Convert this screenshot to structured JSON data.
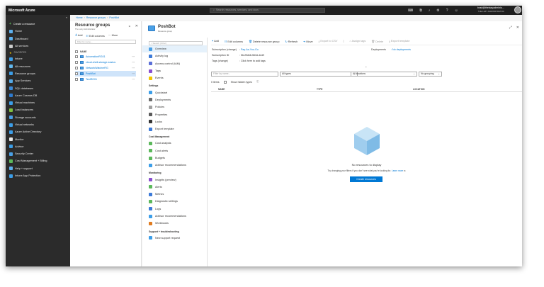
{
  "topbar": {
    "brand": "Microsoft Azure",
    "search_placeholder": "Search resources, services, and docs",
    "user_name": "brad@thelazyadminis...",
    "user_org": "THE LAZY ADMINISTRATOR"
  },
  "leftnav": {
    "collapse": "«",
    "create": "Create a resource",
    "items_top": [
      {
        "label": "Home",
        "color": "#5db0ee"
      },
      {
        "label": "Dashboard",
        "color": "#5db0ee"
      },
      {
        "label": "All services",
        "color": "#cccccc"
      }
    ],
    "favorites_label": "FAVORITES",
    "favorites": [
      {
        "label": "Intune",
        "color": "#3c9ee8"
      },
      {
        "label": "All resources",
        "color": "#62b8ee"
      },
      {
        "label": "Resource groups",
        "color": "#3c9ee8"
      },
      {
        "label": "App Services",
        "color": "#55a9e6"
      },
      {
        "label": "SQL databases",
        "color": "#3c8ad8"
      },
      {
        "label": "Azure Cosmos DB",
        "color": "#2d7bd0"
      },
      {
        "label": "Virtual machines",
        "color": "#3c9ee8"
      },
      {
        "label": "Load balancers",
        "color": "#7fbf3f"
      },
      {
        "label": "Storage accounts",
        "color": "#4aa0e6"
      },
      {
        "label": "Virtual networks",
        "color": "#3c9ee8"
      },
      {
        "label": "Azure Active Directory",
        "color": "#3c9ee8"
      },
      {
        "label": "Monitor",
        "color": "#e8e8e8"
      },
      {
        "label": "Advisor",
        "color": "#3c9ee8"
      },
      {
        "label": "Security Center",
        "color": "#4aa0e6"
      },
      {
        "label": "Cost Management + Billing",
        "color": "#5bb85b"
      },
      {
        "label": "Help + support",
        "color": "#5db0ee"
      },
      {
        "label": "Intune App Protection",
        "color": "#3c9ee8"
      }
    ]
  },
  "breadcrumb": [
    "Home",
    "Resource groups",
    "PoshBot"
  ],
  "rg_blade": {
    "title": "Resource groups",
    "subtitle": "The Lazy Administrator",
    "add": "Add",
    "edit_columns": "Edit columns",
    "more": "More",
    "filter_placeholder": "Filter by name...",
    "col_name": "NAME",
    "rows": [
      {
        "name": "AutomationRG01",
        "selected": false
      },
      {
        "name": "cloud-shell-storage-eastus",
        "selected": false
      },
      {
        "name": "NetworkWatcherRG",
        "selected": false
      },
      {
        "name": "PoshBot",
        "selected": true
      },
      {
        "name": "TestRG01",
        "selected": false
      }
    ]
  },
  "posh_blade": {
    "title": "PoshBot",
    "subtitle": "Resource group",
    "menu_search_placeholder": "Search (Ctrl+/)",
    "menu": [
      {
        "type": "item",
        "label": "Overview",
        "icon": "overview-icon",
        "color": "#4aa0e6",
        "active": true
      },
      {
        "type": "item",
        "label": "Activity log",
        "icon": "activity-log-icon",
        "color": "#3c7ad8"
      },
      {
        "type": "item",
        "label": "Access control (IAM)",
        "icon": "iam-icon",
        "color": "#5a6fd8"
      },
      {
        "type": "item",
        "label": "Tags",
        "icon": "tag-icon",
        "color": "#8a4fd0"
      },
      {
        "type": "item",
        "label": "Events",
        "icon": "events-icon",
        "color": "#f2c500"
      },
      {
        "type": "section",
        "label": "Settings"
      },
      {
        "type": "item",
        "label": "Quickstart",
        "icon": "quickstart-icon",
        "color": "#3c9ee8"
      },
      {
        "type": "item",
        "label": "Deployments",
        "icon": "deployments-icon",
        "color": "#6b6b6b"
      },
      {
        "type": "item",
        "label": "Policies",
        "icon": "policies-icon",
        "color": "#a0a0a0"
      },
      {
        "type": "item",
        "label": "Properties",
        "icon": "properties-icon",
        "color": "#5a5a5a"
      },
      {
        "type": "item",
        "label": "Locks",
        "icon": "lock-icon",
        "color": "#333333"
      },
      {
        "type": "item",
        "label": "Export template",
        "icon": "export-template-icon",
        "color": "#3c7ad8"
      },
      {
        "type": "section",
        "label": "Cost Management"
      },
      {
        "type": "item",
        "label": "Cost analysis",
        "icon": "cost-analysis-icon",
        "color": "#5bb85b"
      },
      {
        "type": "item",
        "label": "Cost alerts",
        "icon": "cost-alerts-icon",
        "color": "#5bb85b"
      },
      {
        "type": "item",
        "label": "Budgets",
        "icon": "budgets-icon",
        "color": "#5bb85b"
      },
      {
        "type": "item",
        "label": "Advisor recommendations",
        "icon": "advisor-icon",
        "color": "#3c9ee8"
      },
      {
        "type": "section",
        "label": "Monitoring"
      },
      {
        "type": "item",
        "label": "Insights (preview)",
        "icon": "insights-icon",
        "color": "#8a4fd0"
      },
      {
        "type": "item",
        "label": "Alerts",
        "icon": "alerts-icon",
        "color": "#5bb85b"
      },
      {
        "type": "item",
        "label": "Metrics",
        "icon": "metrics-icon",
        "color": "#3c7ad8"
      },
      {
        "type": "item",
        "label": "Diagnostic settings",
        "icon": "diagnostic-icon",
        "color": "#5bb85b"
      },
      {
        "type": "item",
        "label": "Logs",
        "icon": "logs-icon",
        "color": "#3c7ad8"
      },
      {
        "type": "item",
        "label": "Advisor recommendations",
        "icon": "advisor-icon",
        "color": "#3c9ee8"
      },
      {
        "type": "item",
        "label": "Workbooks",
        "icon": "workbooks-icon",
        "color": "#e07b1f"
      },
      {
        "type": "section",
        "label": "Support + troubleshooting"
      },
      {
        "type": "item",
        "label": "New support request",
        "icon": "support-icon",
        "color": "#3c9ee8"
      }
    ],
    "cmd": {
      "add": "Add",
      "edit_columns": "Edit columns",
      "delete_rg": "Delete resource group",
      "refresh": "Refresh",
      "move": "Move",
      "export_csv": "Export to CSV",
      "assign_tags": "Assign tags",
      "delete": "Delete",
      "export_template": "Export template"
    },
    "essentials": {
      "subscription_label": "Subscription (change)",
      "subscription_value": "Pay-As-You-Go",
      "subscription_id_label": "Subscription ID",
      "subscription_id_value": ": 5bc9fdb8-563d-4ed9",
      "tags_label": "Tags (change)",
      "tags_value": ": Click here to add tags",
      "deployments_label": "Deployments",
      "deployments_value": ": No deployments"
    },
    "filters": {
      "name_placeholder": "Filter by name...",
      "types": "All types",
      "locations": "All locations",
      "grouping": "No grouping"
    },
    "items_count": "0 items",
    "show_hidden": "Show hidden types",
    "columns": {
      "name": "NAME",
      "type": "TYPE",
      "location": "LOCATION"
    },
    "empty_title": "No resources to display",
    "empty_sub": "Try changing your filters if you don't see what you're looking for.",
    "learn_more": "Learn more",
    "create_button": "Create resources"
  }
}
